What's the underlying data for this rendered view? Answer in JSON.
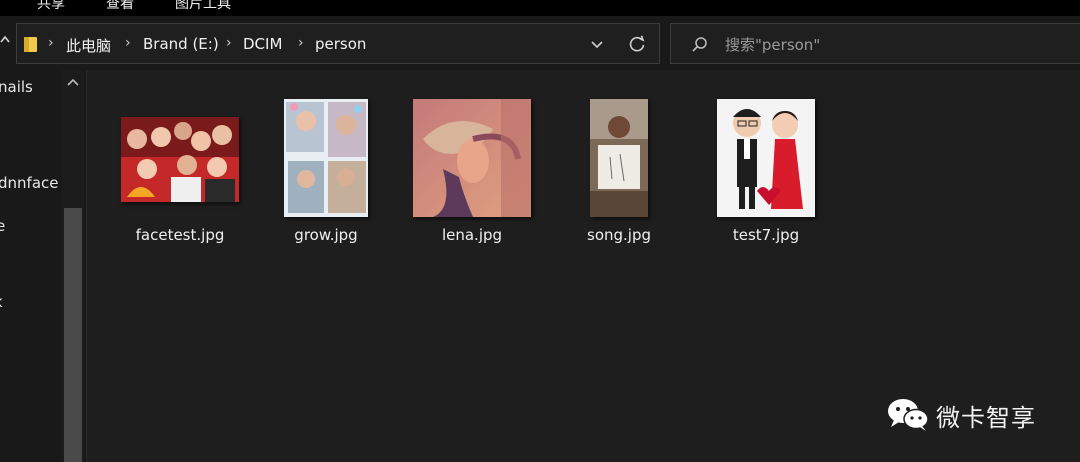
{
  "ribbon": {
    "tabs": [
      "共享",
      "查看",
      "图片工具"
    ]
  },
  "address_bar": {
    "breadcrumbs": [
      "此电脑",
      "Brand (E:)",
      "DCIM",
      "person"
    ],
    "separator": "›"
  },
  "search": {
    "placeholder": "搜索\"person\""
  },
  "nav_pane": {
    "items": [
      "nails",
      "dnnface",
      "e",
      "k"
    ]
  },
  "files": [
    {
      "name": "facetest.jpg"
    },
    {
      "name": "grow.jpg"
    },
    {
      "name": "lena.jpg"
    },
    {
      "name": "song.jpg"
    },
    {
      "name": "test7.jpg"
    }
  ],
  "icons": {
    "up": "chevron-up-icon",
    "folder": "folder-icon",
    "dropdown": "chevron-down-icon",
    "refresh": "refresh-icon",
    "search": "search-icon",
    "watermark_logo": "wechat-icon"
  },
  "watermark": {
    "text": "微卡智享"
  },
  "colors": {
    "background": "#191919",
    "content_bg": "#1e1e1e",
    "folder": "#f2c94c",
    "text": "#f0f0f0",
    "muted_text": "#9a9a9a"
  }
}
